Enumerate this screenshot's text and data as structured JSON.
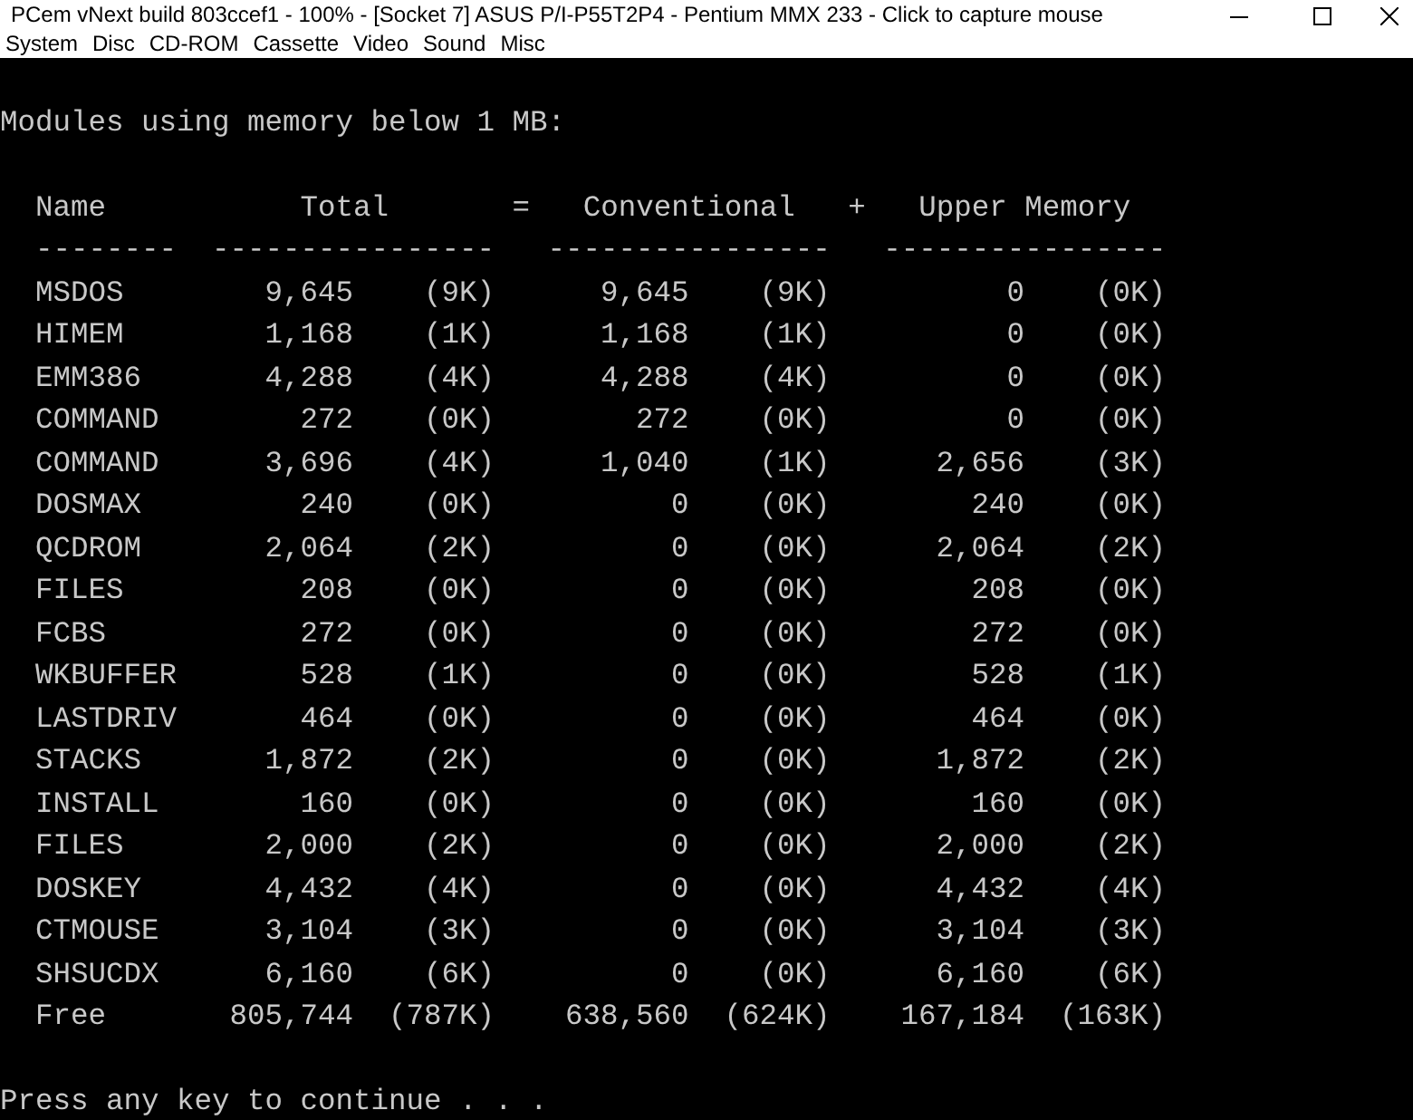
{
  "window": {
    "title": "PCem vNext build 803ccef1 - 100% - [Socket 7] ASUS P/I-P55T2P4 - Pentium MMX 233 - Click to capture mouse"
  },
  "menu": [
    "System",
    "Disc",
    "CD-ROM",
    "Cassette",
    "Video",
    "Sound",
    "Misc"
  ],
  "console": {
    "heading": "Modules using memory below 1 MB:",
    "header": [
      "Name",
      "Total",
      "=",
      "Conventional",
      "+",
      "Upper Memory"
    ],
    "separators": [
      "--------",
      "----------------",
      "----------------",
      "----------------"
    ],
    "rows": [
      {
        "name": "MSDOS",
        "total": "9,645",
        "total_k": "(9K)",
        "conventional": "9,645",
        "conventional_k": "(9K)",
        "upper": "0",
        "upper_k": "(0K)"
      },
      {
        "name": "HIMEM",
        "total": "1,168",
        "total_k": "(1K)",
        "conventional": "1,168",
        "conventional_k": "(1K)",
        "upper": "0",
        "upper_k": "(0K)"
      },
      {
        "name": "EMM386",
        "total": "4,288",
        "total_k": "(4K)",
        "conventional": "4,288",
        "conventional_k": "(4K)",
        "upper": "0",
        "upper_k": "(0K)"
      },
      {
        "name": "COMMAND",
        "total": "272",
        "total_k": "(0K)",
        "conventional": "272",
        "conventional_k": "(0K)",
        "upper": "0",
        "upper_k": "(0K)"
      },
      {
        "name": "COMMAND",
        "total": "3,696",
        "total_k": "(4K)",
        "conventional": "1,040",
        "conventional_k": "(1K)",
        "upper": "2,656",
        "upper_k": "(3K)"
      },
      {
        "name": "DOSMAX",
        "total": "240",
        "total_k": "(0K)",
        "conventional": "0",
        "conventional_k": "(0K)",
        "upper": "240",
        "upper_k": "(0K)"
      },
      {
        "name": "QCDROM",
        "total": "2,064",
        "total_k": "(2K)",
        "conventional": "0",
        "conventional_k": "(0K)",
        "upper": "2,064",
        "upper_k": "(2K)"
      },
      {
        "name": "FILES",
        "total": "208",
        "total_k": "(0K)",
        "conventional": "0",
        "conventional_k": "(0K)",
        "upper": "208",
        "upper_k": "(0K)"
      },
      {
        "name": "FCBS",
        "total": "272",
        "total_k": "(0K)",
        "conventional": "0",
        "conventional_k": "(0K)",
        "upper": "272",
        "upper_k": "(0K)"
      },
      {
        "name": "WKBUFFER",
        "total": "528",
        "total_k": "(1K)",
        "conventional": "0",
        "conventional_k": "(0K)",
        "upper": "528",
        "upper_k": "(1K)"
      },
      {
        "name": "LASTDRIV",
        "total": "464",
        "total_k": "(0K)",
        "conventional": "0",
        "conventional_k": "(0K)",
        "upper": "464",
        "upper_k": "(0K)"
      },
      {
        "name": "STACKS",
        "total": "1,872",
        "total_k": "(2K)",
        "conventional": "0",
        "conventional_k": "(0K)",
        "upper": "1,872",
        "upper_k": "(2K)"
      },
      {
        "name": "INSTALL",
        "total": "160",
        "total_k": "(0K)",
        "conventional": "0",
        "conventional_k": "(0K)",
        "upper": "160",
        "upper_k": "(0K)"
      },
      {
        "name": "FILES",
        "total": "2,000",
        "total_k": "(2K)",
        "conventional": "0",
        "conventional_k": "(0K)",
        "upper": "2,000",
        "upper_k": "(2K)"
      },
      {
        "name": "DOSKEY",
        "total": "4,432",
        "total_k": "(4K)",
        "conventional": "0",
        "conventional_k": "(0K)",
        "upper": "4,432",
        "upper_k": "(4K)"
      },
      {
        "name": "CTMOUSE",
        "total": "3,104",
        "total_k": "(3K)",
        "conventional": "0",
        "conventional_k": "(0K)",
        "upper": "3,104",
        "upper_k": "(3K)"
      },
      {
        "name": "SHSUCDX",
        "total": "6,160",
        "total_k": "(6K)",
        "conventional": "0",
        "conventional_k": "(0K)",
        "upper": "6,160",
        "upper_k": "(6K)"
      },
      {
        "name": "Free",
        "total": "805,744",
        "total_k": "(787K)",
        "conventional": "638,560",
        "conventional_k": "(624K)",
        "upper": "167,184",
        "upper_k": "(163K)"
      }
    ],
    "prompt": "Press any key to continue . . ."
  }
}
